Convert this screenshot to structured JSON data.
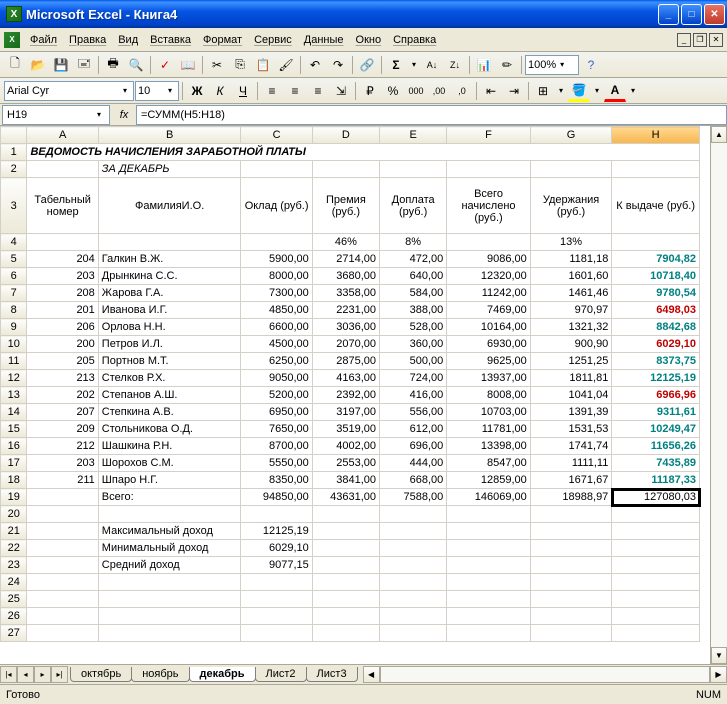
{
  "app": {
    "title": "Microsoft Excel - Книга4"
  },
  "menu": {
    "file": "Файл",
    "edit": "Правка",
    "view": "Вид",
    "insert": "Вставка",
    "format": "Формат",
    "tools": "Сервис",
    "data": "Данные",
    "window": "Окно",
    "help": "Справка"
  },
  "toolbar": {
    "zoom": "100%"
  },
  "format": {
    "font": "Arial Cyr",
    "size": "10"
  },
  "formula": {
    "cell": "H19",
    "value": "=СУММ(H5:H18)"
  },
  "cols": [
    "A",
    "B",
    "C",
    "D",
    "E",
    "F",
    "G",
    "H"
  ],
  "title_row": "ВЕДОМОСТЬ НАЧИСЛЕНИЯ ЗАРАБОТНОЙ ПЛАТЫ",
  "subtitle": "ЗА ДЕКАБРЬ",
  "headers": {
    "a": "Табельный номер",
    "b": "ФамилияИ.О.",
    "c": "Оклад (руб.)",
    "d": "Премия (руб.)",
    "e": "Доплата (руб.)",
    "f": "Всего начислено (руб.)",
    "g": "Удержания (руб.)",
    "h": "К выдаче (руб.)"
  },
  "percents": {
    "d": "46%",
    "e": "8%",
    "g": "13%"
  },
  "rows": [
    {
      "n": "204",
      "name": "Галкин В.Ж.",
      "c": "5900,00",
      "d": "2714,00",
      "e": "472,00",
      "f": "9086,00",
      "g": "1181,18",
      "h": "7904,82",
      "color": "teal"
    },
    {
      "n": "203",
      "name": "Дрынкина С.С.",
      "c": "8000,00",
      "d": "3680,00",
      "e": "640,00",
      "f": "12320,00",
      "g": "1601,60",
      "h": "10718,40",
      "color": "teal"
    },
    {
      "n": "208",
      "name": "Жарова Г.А.",
      "c": "7300,00",
      "d": "3358,00",
      "e": "584,00",
      "f": "11242,00",
      "g": "1461,46",
      "h": "9780,54",
      "color": "teal"
    },
    {
      "n": "201",
      "name": "Иванова И.Г.",
      "c": "4850,00",
      "d": "2231,00",
      "e": "388,00",
      "f": "7469,00",
      "g": "970,97",
      "h": "6498,03",
      "color": "red"
    },
    {
      "n": "206",
      "name": "Орлова Н.Н.",
      "c": "6600,00",
      "d": "3036,00",
      "e": "528,00",
      "f": "10164,00",
      "g": "1321,32",
      "h": "8842,68",
      "color": "teal"
    },
    {
      "n": "200",
      "name": "Петров И.Л.",
      "c": "4500,00",
      "d": "2070,00",
      "e": "360,00",
      "f": "6930,00",
      "g": "900,90",
      "h": "6029,10",
      "color": "red"
    },
    {
      "n": "205",
      "name": "Портнов М.Т.",
      "c": "6250,00",
      "d": "2875,00",
      "e": "500,00",
      "f": "9625,00",
      "g": "1251,25",
      "h": "8373,75",
      "color": "teal"
    },
    {
      "n": "213",
      "name": "Стелков Р.Х.",
      "c": "9050,00",
      "d": "4163,00",
      "e": "724,00",
      "f": "13937,00",
      "g": "1811,81",
      "h": "12125,19",
      "color": "teal"
    },
    {
      "n": "202",
      "name": "Степанов А.Ш.",
      "c": "5200,00",
      "d": "2392,00",
      "e": "416,00",
      "f": "8008,00",
      "g": "1041,04",
      "h": "6966,96",
      "color": "red"
    },
    {
      "n": "207",
      "name": "Степкина А.В.",
      "c": "6950,00",
      "d": "3197,00",
      "e": "556,00",
      "f": "10703,00",
      "g": "1391,39",
      "h": "9311,61",
      "color": "teal"
    },
    {
      "n": "209",
      "name": "Стольникова О.Д.",
      "c": "7650,00",
      "d": "3519,00",
      "e": "612,00",
      "f": "11781,00",
      "g": "1531,53",
      "h": "10249,47",
      "color": "teal"
    },
    {
      "n": "212",
      "name": "Шашкина Р.Н.",
      "c": "8700,00",
      "d": "4002,00",
      "e": "696,00",
      "f": "13398,00",
      "g": "1741,74",
      "h": "11656,26",
      "color": "teal"
    },
    {
      "n": "203",
      "name": "Шорохов С.М.",
      "c": "5550,00",
      "d": "2553,00",
      "e": "444,00",
      "f": "8547,00",
      "g": "1111,11",
      "h": "7435,89",
      "color": "teal"
    },
    {
      "n": "211",
      "name": "Шпаро Н.Г.",
      "c": "8350,00",
      "d": "3841,00",
      "e": "668,00",
      "f": "12859,00",
      "g": "1671,67",
      "h": "11187,33",
      "color": "teal"
    }
  ],
  "totals": {
    "label": "Всего:",
    "c": "94850,00",
    "d": "43631,00",
    "e": "7588,00",
    "f": "146069,00",
    "g": "18988,97",
    "h": "127080,03"
  },
  "stats": {
    "max": {
      "label": "Максимальный доход",
      "val": "12125,19"
    },
    "min": {
      "label": "Минимальный доход",
      "val": "6029,10"
    },
    "avg": {
      "label": "Средний доход",
      "val": "9077,15"
    }
  },
  "tabs": [
    "октябрь",
    "ноябрь",
    "декабрь",
    "Лист2",
    "Лист3"
  ],
  "active_tab": 2,
  "status": {
    "ready": "Готово",
    "num": "NUM"
  }
}
